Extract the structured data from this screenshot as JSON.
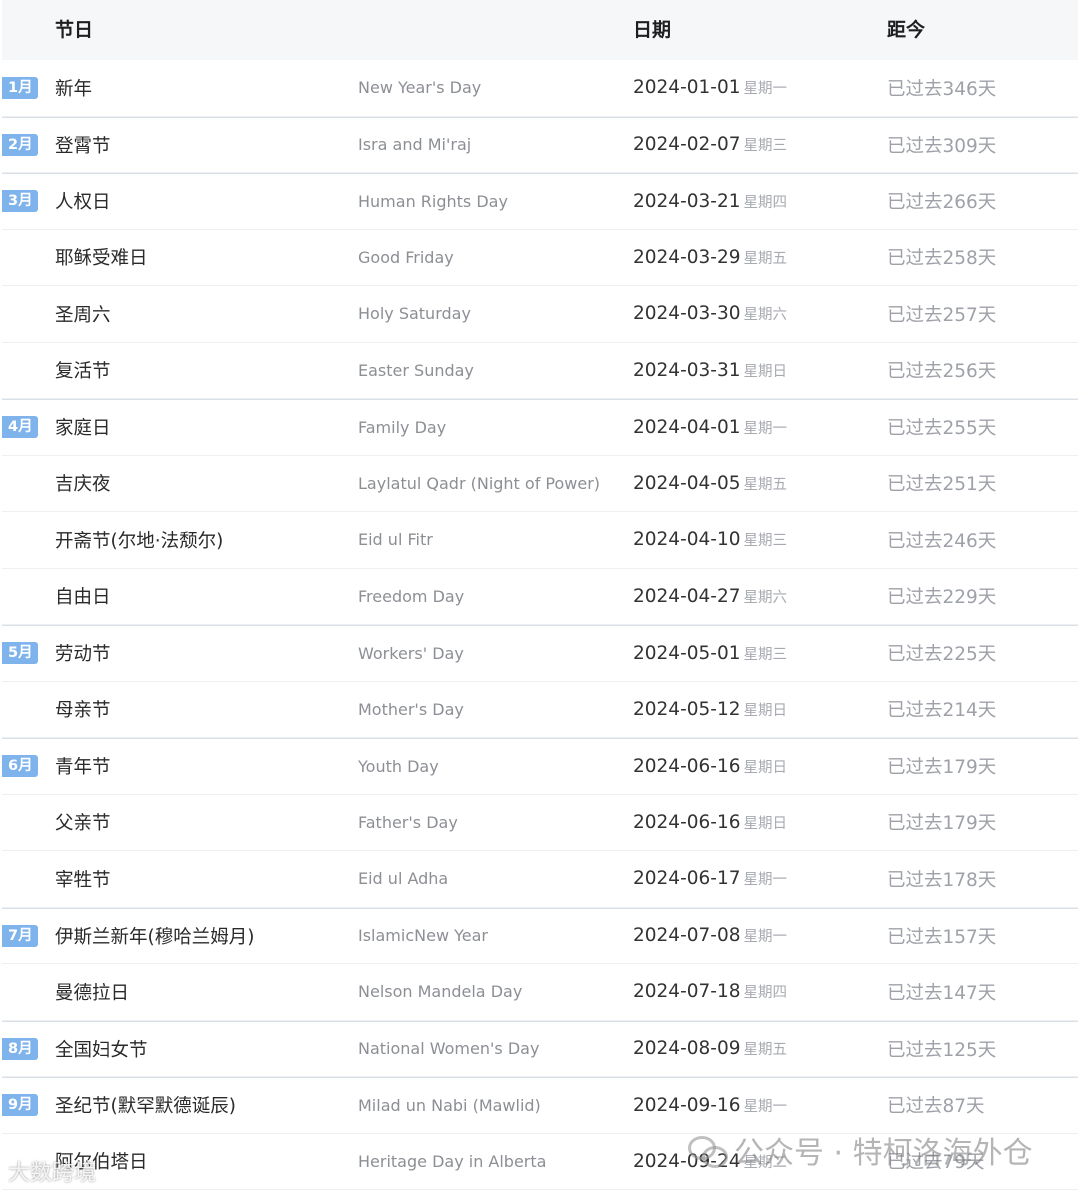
{
  "header": {
    "col_holiday": "节日",
    "col_date": "日期",
    "col_distance": "距今"
  },
  "colors": {
    "badge": "#7fb3ec",
    "header_bg": "#f6f7f9"
  },
  "rows": [
    {
      "month": "1月",
      "name": "新年",
      "en": "New Year's Day",
      "date": "2024-01-01",
      "weekday": "星期一",
      "distance": "已过去346天"
    },
    {
      "month": "2月",
      "name": "登霄节",
      "en": "Isra and Mi'raj",
      "date": "2024-02-07",
      "weekday": "星期三",
      "distance": "已过去309天"
    },
    {
      "month": "3月",
      "name": "人权日",
      "en": "Human Rights Day",
      "date": "2024-03-21",
      "weekday": "星期四",
      "distance": "已过去266天"
    },
    {
      "month": "",
      "name": "耶稣受难日",
      "en": "Good Friday",
      "date": "2024-03-29",
      "weekday": "星期五",
      "distance": "已过去258天"
    },
    {
      "month": "",
      "name": "圣周六",
      "en": "Holy Saturday",
      "date": "2024-03-30",
      "weekday": "星期六",
      "distance": "已过去257天"
    },
    {
      "month": "",
      "name": "复活节",
      "en": "Easter Sunday",
      "date": "2024-03-31",
      "weekday": "星期日",
      "distance": "已过去256天"
    },
    {
      "month": "4月",
      "name": "家庭日",
      "en": "Family Day",
      "date": "2024-04-01",
      "weekday": "星期一",
      "distance": "已过去255天"
    },
    {
      "month": "",
      "name": "吉庆夜",
      "en": "Laylatul Qadr (Night of Power)",
      "date": "2024-04-05",
      "weekday": "星期五",
      "distance": "已过去251天"
    },
    {
      "month": "",
      "name": "开斋节(尔地·法颓尔)",
      "en": "Eid ul Fitr",
      "date": "2024-04-10",
      "weekday": "星期三",
      "distance": "已过去246天"
    },
    {
      "month": "",
      "name": "自由日",
      "en": "Freedom Day",
      "date": "2024-04-27",
      "weekday": "星期六",
      "distance": "已过去229天"
    },
    {
      "month": "5月",
      "name": "劳动节",
      "en": "Workers' Day",
      "date": "2024-05-01",
      "weekday": "星期三",
      "distance": "已过去225天"
    },
    {
      "month": "",
      "name": "母亲节",
      "en": "Mother's Day",
      "date": "2024-05-12",
      "weekday": "星期日",
      "distance": "已过去214天"
    },
    {
      "month": "6月",
      "name": "青年节",
      "en": "Youth Day",
      "date": "2024-06-16",
      "weekday": "星期日",
      "distance": "已过去179天"
    },
    {
      "month": "",
      "name": "父亲节",
      "en": "Father's Day",
      "date": "2024-06-16",
      "weekday": "星期日",
      "distance": "已过去179天"
    },
    {
      "month": "",
      "name": "宰牲节",
      "en": "Eid ul Adha",
      "date": "2024-06-17",
      "weekday": "星期一",
      "distance": "已过去178天"
    },
    {
      "month": "7月",
      "name": "伊斯兰新年(穆哈兰姆月)",
      "en": "IslamicNew Year",
      "date": "2024-07-08",
      "weekday": "星期一",
      "distance": "已过去157天"
    },
    {
      "month": "",
      "name": "曼德拉日",
      "en": "Nelson Mandela Day",
      "date": "2024-07-18",
      "weekday": "星期四",
      "distance": "已过去147天"
    },
    {
      "month": "8月",
      "name": "全国妇女节",
      "en": "National Women's Day",
      "date": "2024-08-09",
      "weekday": "星期五",
      "distance": "已过去125天"
    },
    {
      "month": "9月",
      "name": "圣纪节(默罕默德诞辰)",
      "en": "Milad un Nabi (Mawlid)",
      "date": "2024-09-16",
      "weekday": "星期一",
      "distance": "已过去87天"
    },
    {
      "month": "",
      "name": "阿尔伯塔日",
      "en": "Heritage Day in Alberta",
      "date": "2024-09-24",
      "weekday": "星期二",
      "distance": "已过去79天"
    }
  ],
  "watermark": {
    "text": "公众号 · 特柯洛海外仓",
    "corner": "大数跨境"
  }
}
